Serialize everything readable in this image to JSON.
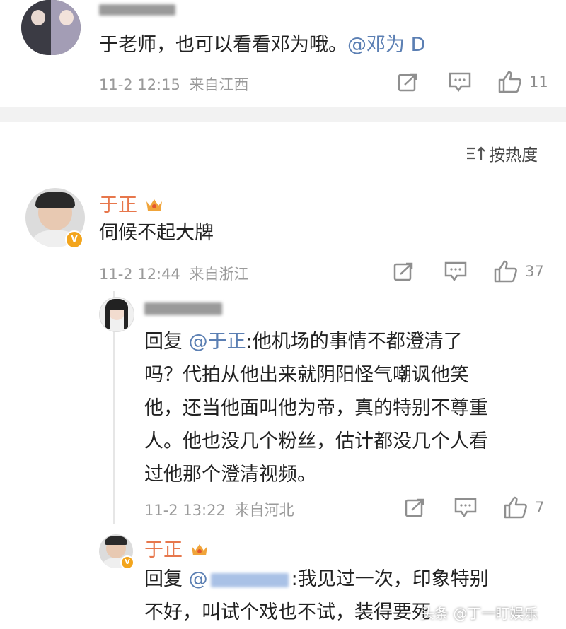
{
  "top_comment": {
    "text": "于老师，也可以看看邓为哦。",
    "mention": "@邓为 D",
    "time": "11-2 12:15",
    "location": "来自江西",
    "like_count": "11"
  },
  "sort": {
    "label": "按热度",
    "icon": "sort-icon"
  },
  "reply1": {
    "username": "于正",
    "text": "伺候不起大牌",
    "time": "11-2 12:44",
    "location": "来自浙江",
    "like_count": "37",
    "badge": "V"
  },
  "reply2": {
    "prefix": "回复",
    "mention": "@于正",
    "text_line1": ":他机场的事情不都澄清了",
    "text_line2": "吗？代拍从他出来就阴阳怪气嘲讽他笑",
    "text_line3": "他，还当他面叫他为帝，真的特别不尊重",
    "text_line4": "人。他也没几个粉丝，估计都没几个人看",
    "text_line5": "过他那个澄清视频。",
    "time": "11-2 13:22",
    "location": "来自河北",
    "like_count": "7"
  },
  "reply3": {
    "username": "于正",
    "prefix": "回复",
    "mention": "@",
    "text_line1": ":我见过一次，印象特别",
    "text_line2": "不好，叫试个戏也不试，装得要死"
  },
  "watermark": "头条 @丁一盯娱乐",
  "colors": {
    "username": "#e7774c",
    "mention": "#5b7fb3",
    "meta": "#9a9a9a",
    "divider": "#f2f2f2"
  }
}
